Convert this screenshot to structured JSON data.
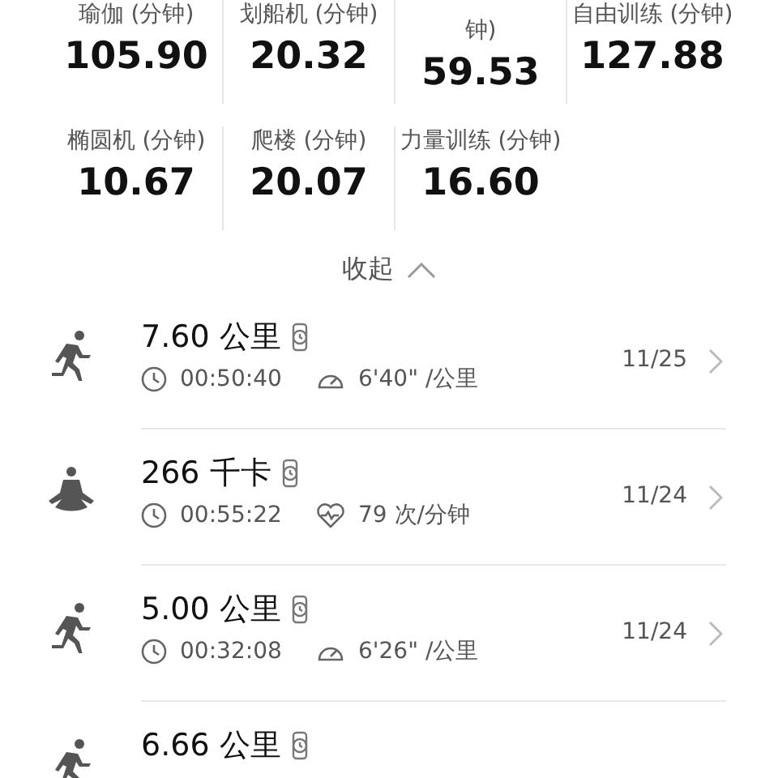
{
  "stats": [
    {
      "label": "瑜伽 (分钟)",
      "value": "105.90"
    },
    {
      "label": "划船机 (分钟)",
      "value": "20.32"
    },
    {
      "label": "钟)",
      "value": "59.53"
    },
    {
      "label": "自由训练 (分钟)",
      "value": "127.88"
    },
    {
      "label": "椭圆机 (分钟)",
      "value": "10.67"
    },
    {
      "label": "爬楼 (分钟)",
      "value": "20.07"
    },
    {
      "label": "力量训练 (分钟)",
      "value": "16.60"
    }
  ],
  "collapse": {
    "label": "收起"
  },
  "records": [
    {
      "kind": "run",
      "title": "7.60 公里",
      "duration": "00:50:40",
      "pace": "6'40\" /公里",
      "date": "11/25"
    },
    {
      "kind": "yoga",
      "title": "266 千卡",
      "duration": "00:55:22",
      "heart_rate": "79 次/分钟",
      "date": "11/24"
    },
    {
      "kind": "run",
      "title": "5.00 公里",
      "duration": "00:32:08",
      "pace": "6'26\" /公里",
      "date": "11/24"
    },
    {
      "kind": "run",
      "title": "6.66 公里"
    }
  ]
}
